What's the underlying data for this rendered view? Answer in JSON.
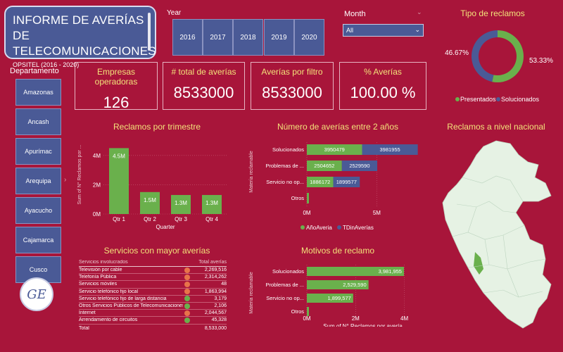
{
  "header": {
    "title": "INFORME DE AVERÍAS DE TELECOMUNICACIONES",
    "subtitle": "OPSITEL (2016 - 2020)"
  },
  "filters": {
    "year_label": "Year",
    "years": [
      "2016",
      "2017",
      "2018",
      "2019",
      "2020"
    ],
    "month_label": "Month",
    "month_value": "All"
  },
  "kpis": [
    {
      "title": "Empresas operadoras",
      "value": "126"
    },
    {
      "title": "# total de averías",
      "value": "8533000"
    },
    {
      "title": "Averías por filtro",
      "value": "8533000"
    },
    {
      "title": "% Averías",
      "value": "100.00 %"
    }
  ],
  "departamento": {
    "label": "Departamento",
    "items": [
      "Amazonas",
      "Ancash",
      "Apurímac",
      "Arequipa",
      "Ayacucho",
      "Cajamarca",
      "Cusco"
    ]
  },
  "sections": {
    "trimestre": "Reclamos por trimestre",
    "dos_anos": "Número de averías entre 2 años",
    "servicios": "Servicios con mayor averías",
    "motivos": "Motivos de reclamo",
    "tipo": "Tipo de reclamos",
    "nacional": "Reclamos a nivel nacional"
  },
  "colors": {
    "green": "#6ab04c",
    "blue": "#4a5a96",
    "bg": "#a8153a",
    "red": "#e8734a",
    "yellow": "#f3e27a"
  },
  "chart_data": [
    {
      "type": "bar",
      "id": "quarter",
      "categories": [
        "Qtr 1",
        "Qtr 2",
        "Qtr 3",
        "Qtr 4"
      ],
      "values": [
        4.5,
        1.5,
        1.3,
        1.3
      ],
      "labels": [
        "4.5M",
        "1.5M",
        "1.3M",
        "1.3M"
      ],
      "xlabel": "Quarter",
      "ylabel": "Sum of N° Reclamos por ...",
      "yticks": [
        "0M",
        "2M",
        "4M"
      ],
      "ylim": [
        0,
        5
      ]
    },
    {
      "type": "bar",
      "id": "twoyears",
      "orientation": "horizontal",
      "stacked": true,
      "categories": [
        "Solucionados",
        "Problemas de ...",
        "Servicio no op...",
        "Otros"
      ],
      "ylabel": "Materia reclamable",
      "xticks": [
        "0M",
        "5M"
      ],
      "xlim": [
        0,
        8
      ],
      "series": [
        {
          "name": "AñoAveria",
          "values": [
            3950479,
            2504652,
            1886172,
            0
          ]
        },
        {
          "name": "TDinAverías",
          "values": [
            3981955,
            2529590,
            1899577,
            0
          ]
        }
      ],
      "value_labels": [
        [
          "3950479",
          "2504652",
          "1886172",
          ""
        ],
        [
          "3981955",
          "2529590",
          "1899577",
          ""
        ]
      ]
    },
    {
      "type": "bar",
      "id": "motivos",
      "orientation": "horizontal",
      "categories": [
        "Solucionados",
        "Problemas de ...",
        "Servicio no op...",
        "Otros"
      ],
      "values": [
        3981955,
        2529590,
        1899577,
        0
      ],
      "labels": [
        "3,981,955",
        "2,529,590",
        "1,899,577",
        ""
      ],
      "xlabel": "Sum of N° Reclamos por avería",
      "ylabel": "Materia reclamable",
      "xticks": [
        "0M",
        "2M",
        "4M"
      ],
      "xlim": [
        0,
        4.3
      ]
    },
    {
      "type": "pie",
      "id": "tipo",
      "donut": true,
      "slices": [
        {
          "name": "Presentados",
          "value": 53.33,
          "label": "53.33%"
        },
        {
          "name": "Solucionados",
          "value": 46.67,
          "label": "46.67%"
        }
      ]
    },
    {
      "type": "table",
      "id": "servicios",
      "columns": [
        "Servicios involucrados",
        "Total averías"
      ],
      "rows": [
        {
          "name": "Televisión por cable",
          "value": "2,269,516",
          "status": "red"
        },
        {
          "name": "Telefonía Pública",
          "value": "2,314,262",
          "status": "red"
        },
        {
          "name": "Servicios móviles",
          "value": "48",
          "status": "red"
        },
        {
          "name": "Servicio telefónico fijo local",
          "value": "1,863,994",
          "status": "red"
        },
        {
          "name": "Servicio telefónico fijo de larga distancia",
          "value": "3,179",
          "status": "green"
        },
        {
          "name": "Otros Servicios Públicos de Telecomunicaciones",
          "value": "2,106",
          "status": "green"
        },
        {
          "name": "Internet",
          "value": "2,044,567",
          "status": "red"
        },
        {
          "name": "Arrendamiento de circuitos",
          "value": "45,328",
          "status": "green"
        }
      ],
      "total_label": "Total",
      "total_value": "8,533,000"
    }
  ]
}
